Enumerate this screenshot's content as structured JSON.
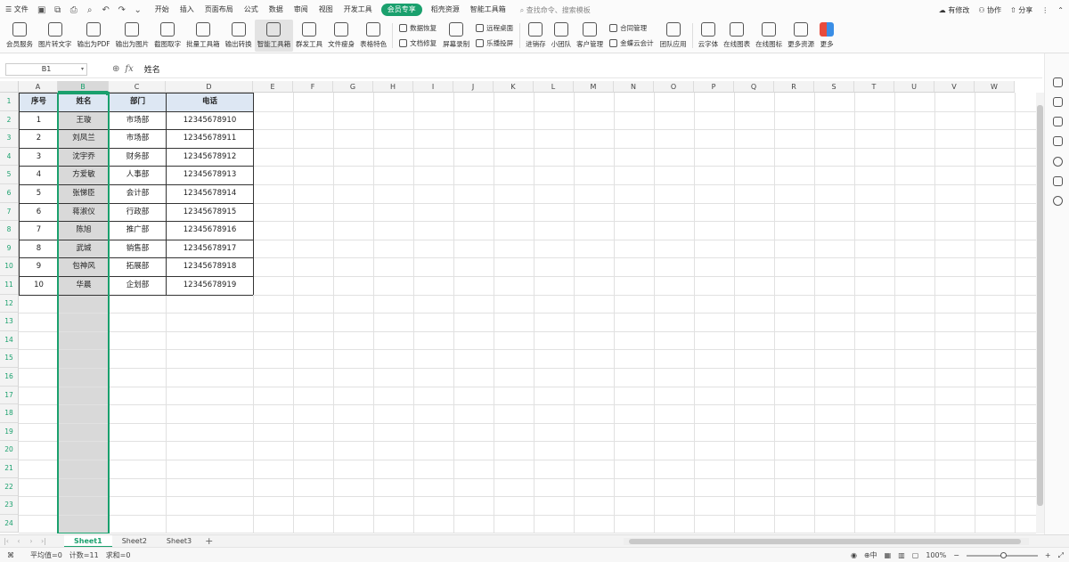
{
  "menubar": {
    "file_label": "文件",
    "items": [
      "开始",
      "插入",
      "页面布局",
      "公式",
      "数据",
      "审阅",
      "视图",
      "开发工具",
      "会员专享",
      "稻壳资源",
      "智能工具箱"
    ],
    "active_item": "会员专享",
    "search_placeholder": "查找命令、搜索模板",
    "right": {
      "changes": "有修改",
      "collab": "协作",
      "share": "分享"
    }
  },
  "ribbon": {
    "buttons": [
      "会员服务",
      "图片转文字",
      "输出为PDF",
      "输出为图片",
      "截图取字",
      "批量工具箱",
      "输出转换",
      "智能工具箱",
      "群发工具",
      "文件瘦身",
      "表格特色"
    ],
    "col1": [
      "数据恢复",
      "文档修复"
    ],
    "btn_screen": "屏幕录制",
    "col2": [
      "远程桌面",
      "乐播投屏"
    ],
    "btn_jxc": "进销存",
    "btn_team": "小团队",
    "btn_crm": "客户管理",
    "col3": [
      "合同管理",
      "金蝶云会计"
    ],
    "btn_teamapp": "团队应用",
    "btn_font": "云字体",
    "btn_chart": "在线图表",
    "btn_icon": "在线图标",
    "btn_res": "更多资源",
    "btn_more": "更多"
  },
  "formula": {
    "namebox": "B1",
    "fx": "fx",
    "content": "姓名"
  },
  "grid": {
    "columns": [
      "A",
      "B",
      "C",
      "D",
      "E",
      "F",
      "G",
      "H",
      "I",
      "J",
      "K",
      "L",
      "M",
      "N",
      "O",
      "P",
      "Q",
      "R",
      "S",
      "T",
      "U",
      "V",
      "W"
    ],
    "selected_column": "B",
    "row_numbers": [
      "1",
      "2",
      "3",
      "4",
      "5",
      "6",
      "7",
      "8",
      "9",
      "10",
      "11",
      "12",
      "13",
      "14",
      "15",
      "16",
      "17",
      "18",
      "19",
      "20",
      "21",
      "22",
      "23",
      "24"
    ]
  },
  "table": {
    "headers": [
      "序号",
      "姓名",
      "部门",
      "电话"
    ],
    "rows": [
      [
        "1",
        "王璇",
        "市场部",
        "12345678910"
      ],
      [
        "2",
        "刘凤兰",
        "市场部",
        "12345678911"
      ],
      [
        "3",
        "沈宇乔",
        "财务部",
        "12345678912"
      ],
      [
        "4",
        "方爱敏",
        "人事部",
        "12345678913"
      ],
      [
        "5",
        "张悌臣",
        "会计部",
        "12345678914"
      ],
      [
        "6",
        "蒋淑仪",
        "行政部",
        "12345678915"
      ],
      [
        "7",
        "陈旭",
        "推广部",
        "12345678916"
      ],
      [
        "8",
        "武城",
        "销售部",
        "12345678917"
      ],
      [
        "9",
        "包神风",
        "拓展部",
        "12345678918"
      ],
      [
        "10",
        "华晨",
        "企划部",
        "12345678919"
      ]
    ]
  },
  "tabs": {
    "sheets": [
      "Sheet1",
      "Sheet2",
      "Sheet3"
    ],
    "active": "Sheet1"
  },
  "status": {
    "average": "平均值=0",
    "count": "计数=11",
    "sum": "求和=0",
    "zoom": "100%"
  },
  "colors": {
    "accent": "#1aa06d",
    "header_fill": "#dde7f3",
    "selection_fill": "#d9d9d9"
  }
}
